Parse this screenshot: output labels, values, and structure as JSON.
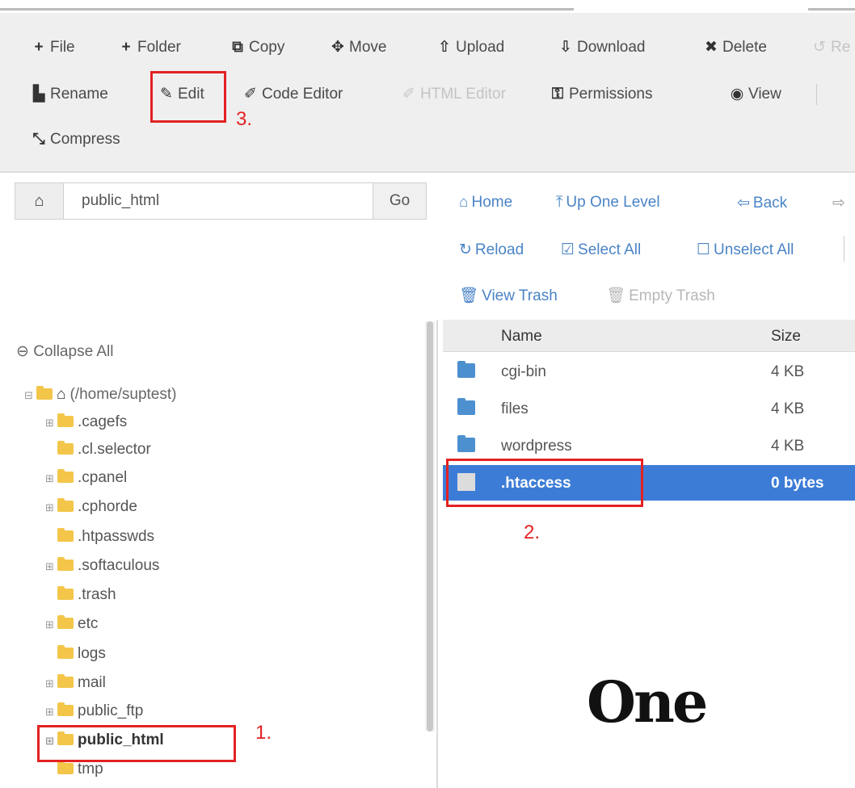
{
  "toolbar": {
    "row1": [
      {
        "label": "File",
        "icon": "plus-icon",
        "glyph": "+",
        "disabled": false
      },
      {
        "label": "Folder",
        "icon": "plus-icon",
        "glyph": "+",
        "disabled": false
      },
      {
        "label": "Copy",
        "icon": "copy-icon",
        "glyph": "⧉",
        "disabled": false
      },
      {
        "label": "Move",
        "icon": "move-icon",
        "glyph": "✥",
        "disabled": false
      },
      {
        "label": "Upload",
        "icon": "upload-icon",
        "glyph": "⇧",
        "disabled": false
      },
      {
        "label": "Download",
        "icon": "download-icon",
        "glyph": "⇩",
        "disabled": false
      },
      {
        "label": "Delete",
        "icon": "close-icon",
        "glyph": "✖",
        "disabled": false
      },
      {
        "label": "Re",
        "icon": "restore-icon",
        "glyph": "↺",
        "disabled": true
      }
    ],
    "row2": [
      {
        "label": "Rename",
        "icon": "rename-icon",
        "glyph": "▙",
        "disabled": false
      },
      {
        "label": "Edit",
        "icon": "pencil-icon",
        "glyph": "✎",
        "disabled": false
      },
      {
        "label": "Code Editor",
        "icon": "code-editor-icon",
        "glyph": "✐",
        "disabled": false
      },
      {
        "label": "HTML Editor",
        "icon": "html-editor-icon",
        "glyph": "✐",
        "disabled": true
      },
      {
        "label": "Permissions",
        "icon": "key-icon",
        "glyph": "⚿",
        "disabled": false
      },
      {
        "label": "View",
        "icon": "eye-icon",
        "glyph": "◉",
        "disabled": false
      }
    ],
    "row3": [
      {
        "label": "Compress",
        "icon": "compress-icon",
        "glyph": "⤡",
        "disabled": false
      }
    ]
  },
  "annotations": {
    "marker1": "1.",
    "marker2": "2.",
    "marker3": "3."
  },
  "path_bar": {
    "home_icon": "home-icon",
    "home_glyph": "⌂",
    "value": "public_html",
    "go_label": "Go"
  },
  "nav": {
    "home": {
      "label": "Home",
      "icon": "home-icon",
      "glyph": "⌂"
    },
    "up": {
      "label": "Up One Level",
      "icon": "up-arrow-icon",
      "glyph": "⤒"
    },
    "back": {
      "label": "Back",
      "icon": "back-arrow-icon",
      "glyph": "⇦"
    },
    "forward_glyph": "⇨",
    "reload": {
      "label": "Reload",
      "icon": "reload-icon",
      "glyph": "↻"
    },
    "select_all": {
      "label": "Select All",
      "icon": "checkbox-checked-icon",
      "glyph": "☑"
    },
    "unselect_all": {
      "label": "Unselect All",
      "icon": "checkbox-empty-icon",
      "glyph": "☐"
    },
    "view_trash": {
      "label": "View Trash",
      "icon": "trash-icon",
      "glyph": "🗑"
    },
    "empty_trash": {
      "label": "Empty Trash",
      "icon": "trash-icon",
      "glyph": "🗑"
    }
  },
  "tree": {
    "collapse_all": "Collapse All",
    "collapse_glyph": "⊖",
    "root_label": "(/home/suptest)",
    "items": [
      {
        "label": ".cagefs",
        "expandable": true
      },
      {
        "label": ".cl.selector",
        "expandable": false
      },
      {
        "label": ".cpanel",
        "expandable": true
      },
      {
        "label": ".cphorde",
        "expandable": true
      },
      {
        "label": ".htpasswds",
        "expandable": false
      },
      {
        "label": ".softaculous",
        "expandable": true
      },
      {
        "label": ".trash",
        "expandable": false
      },
      {
        "label": "etc",
        "expandable": true
      },
      {
        "label": "logs",
        "expandable": false
      },
      {
        "label": "mail",
        "expandable": true
      },
      {
        "label": "public_ftp",
        "expandable": true
      },
      {
        "label": "public_html",
        "expandable": true,
        "active": true
      },
      {
        "label": "tmp",
        "expandable": false
      }
    ]
  },
  "files": {
    "headers": {
      "name": "Name",
      "size": "Size"
    },
    "rows": [
      {
        "name": "cgi-bin",
        "size": "4 KB",
        "type": "folder",
        "selected": false
      },
      {
        "name": "files",
        "size": "4 KB",
        "type": "folder",
        "selected": false
      },
      {
        "name": "wordpress",
        "size": "4 KB",
        "type": "folder",
        "selected": false
      },
      {
        "name": ".htaccess",
        "size": "0 bytes",
        "type": "file",
        "selected": true
      }
    ]
  },
  "logo": {
    "text": "One"
  },
  "colors": {
    "accent_blue": "#4a84c6",
    "selected_row": "#3d7cd6",
    "annotation_red": "#e32222",
    "folder_yellow": "#f3c64a"
  }
}
